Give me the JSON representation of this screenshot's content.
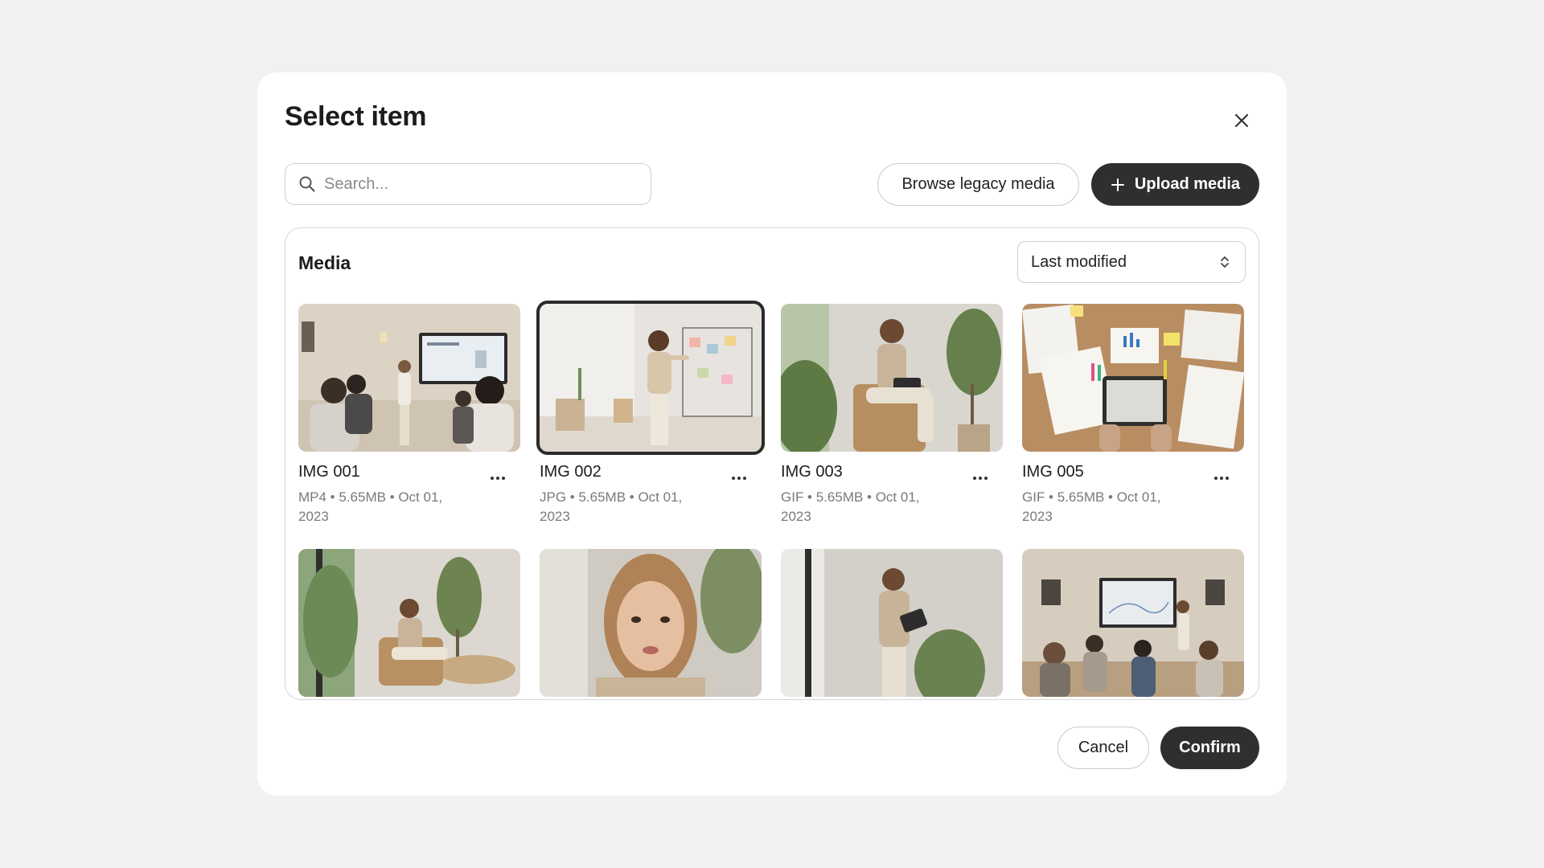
{
  "modal": {
    "title": "Select item",
    "close_icon": "close-icon"
  },
  "toolbar": {
    "search": {
      "placeholder": "Search...",
      "value": "",
      "icon": "search-icon"
    },
    "browse_label": "Browse legacy media",
    "upload_label": "Upload media",
    "upload_icon": "plus-icon"
  },
  "media": {
    "title": "Media",
    "sort": {
      "selected": "Last modified",
      "icon": "chevron-up-down-icon"
    },
    "items": [
      {
        "name": "IMG 001",
        "meta": "MP4 • 5.65MB • Oct 01, 2023",
        "selected": false,
        "scene": "presentation-room"
      },
      {
        "name": "IMG 002",
        "meta": "JPG • 5.65MB • Oct 01, 2023",
        "selected": true,
        "scene": "woman-at-wall-board"
      },
      {
        "name": "IMG 003",
        "meta": "GIF • 5.65MB • Oct 01, 2023",
        "selected": false,
        "scene": "woman-seated-with-tablet"
      },
      {
        "name": "IMG 005",
        "meta": "GIF • 5.65MB • Oct 01, 2023",
        "selected": false,
        "scene": "desk-with-papers-and-tablet"
      },
      {
        "name": "",
        "meta": "",
        "selected": false,
        "scene": "woman-seated-by-window"
      },
      {
        "name": "",
        "meta": "",
        "selected": false,
        "scene": "woman-portrait"
      },
      {
        "name": "",
        "meta": "",
        "selected": false,
        "scene": "woman-standing-with-tablet"
      },
      {
        "name": "",
        "meta": "",
        "selected": false,
        "scene": "conference-audience"
      }
    ]
  },
  "footer": {
    "cancel_label": "Cancel",
    "confirm_label": "Confirm"
  },
  "colors": {
    "page_bg": "#f2f0f0",
    "modal_bg": "#ffffff",
    "primary_dark": "#2f2f2f",
    "border": "#cfcfcf",
    "meta_text": "#7a7a7a"
  }
}
